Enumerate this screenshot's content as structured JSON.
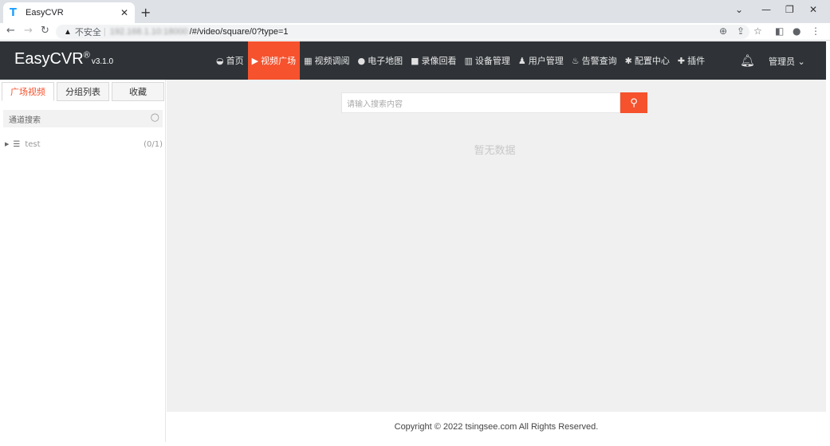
{
  "browser": {
    "tab_title": "EasyCVR",
    "tab_favicon": "T",
    "tab_close": "✕",
    "new_tab": "+",
    "address": {
      "insecure_label": "不安全",
      "host": "192.168.1.10:18000",
      "path": "/#/video/square/0?type=1"
    }
  },
  "header": {
    "brand": "EasyCVR",
    "registered": "®",
    "version": "v3.1.0",
    "menu": [
      {
        "icon": "dashboard-icon",
        "label": "首页",
        "active": false
      },
      {
        "icon": "play-circle-icon",
        "label": "视频广场",
        "active": true
      },
      {
        "icon": "grid-icon",
        "label": "视频调阅",
        "active": false
      },
      {
        "icon": "map-pin-icon",
        "label": "电子地图",
        "active": false
      },
      {
        "icon": "video-camera-icon",
        "label": "录像回看",
        "active": false
      },
      {
        "icon": "device-icon",
        "label": "设备管理",
        "active": false
      },
      {
        "icon": "users-icon",
        "label": "用户管理",
        "active": false
      },
      {
        "icon": "alarm-icon",
        "label": "告警查询",
        "active": false
      },
      {
        "icon": "gear-icon",
        "label": "配置中心",
        "active": false
      },
      {
        "icon": "puzzle-icon",
        "label": "插件",
        "active": false
      }
    ],
    "user": "管理员"
  },
  "sidebar": {
    "tabs": [
      {
        "label": "广场视频",
        "active": true
      },
      {
        "label": "分组列表",
        "active": false
      },
      {
        "label": "收藏",
        "active": false
      }
    ],
    "search_placeholder": "通道搜索",
    "tree": [
      {
        "label": "test",
        "count": "(0/1)"
      }
    ]
  },
  "main": {
    "search_placeholder": "请输入搜索内容",
    "empty_text": "暂无数据"
  },
  "footer": {
    "copyright": "Copyright © 2022 tsingsee.com All Rights Reserved."
  },
  "colors": {
    "accent": "#f5522d",
    "header_bg": "#2f3337",
    "main_bg": "#f0f0f0"
  }
}
